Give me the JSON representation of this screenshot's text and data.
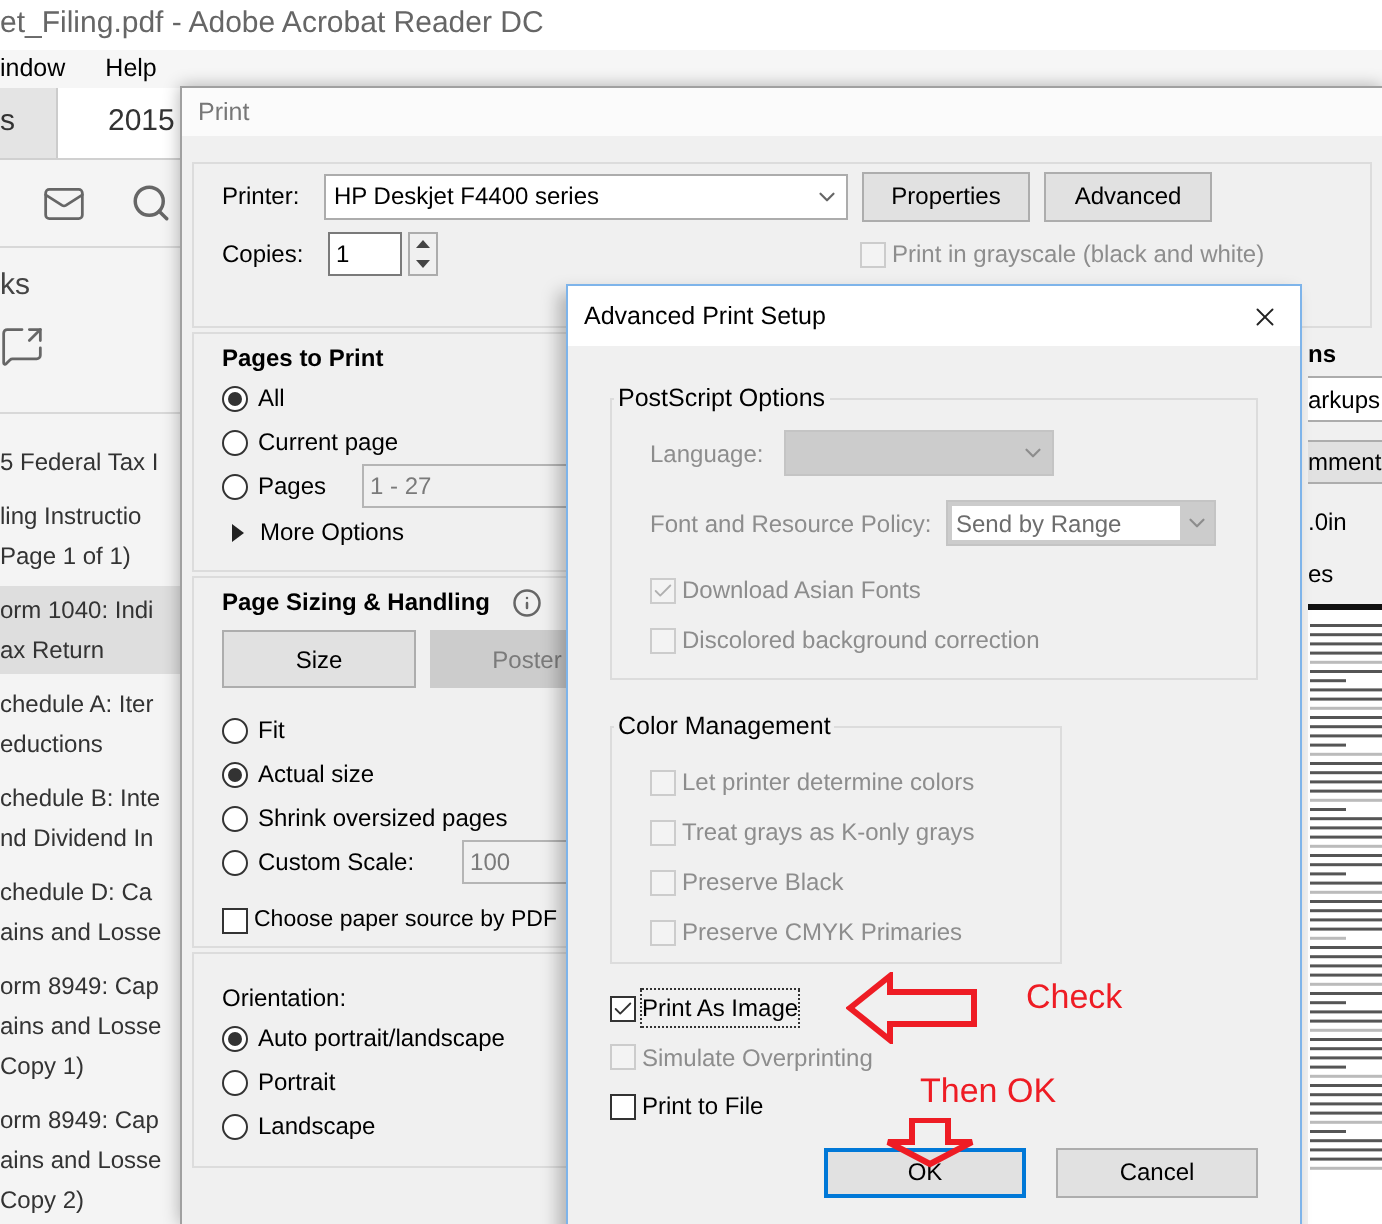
{
  "app_window": {
    "title": "et_Filing.pdf - Adobe Acrobat Reader DC",
    "menu": [
      "indow",
      "Help"
    ],
    "tabs": [
      {
        "label": "s",
        "selected": false
      },
      {
        "label": "2015",
        "selected": true
      }
    ],
    "panel_title": "ks",
    "bookmarks": [
      {
        "lines": [
          "5 Federal Tax I"
        ],
        "selected": false
      },
      {
        "lines": [
          "ling Instructio",
          "Page 1 of 1)"
        ],
        "selected": false
      },
      {
        "lines": [
          "orm 1040: Indi",
          "ax Return"
        ],
        "selected": true
      },
      {
        "lines": [
          "chedule A: Iter",
          "eductions"
        ],
        "selected": false
      },
      {
        "lines": [
          "chedule B: Inte",
          "nd Dividend In"
        ],
        "selected": false
      },
      {
        "lines": [
          "chedule D: Ca",
          "ains and Losse"
        ],
        "selected": false
      },
      {
        "lines": [
          "orm 8949: Cap",
          "ains and Losse",
          "Copy 1)"
        ],
        "selected": false
      },
      {
        "lines": [
          "orm 8949: Cap",
          "ains and Losse",
          "Copy 2)"
        ],
        "selected": false
      }
    ]
  },
  "print_dialog": {
    "title": "Print",
    "printer_label": "Printer:",
    "printer": "HP Deskjet F4400 series",
    "buttons": [
      "Properties",
      "Advanced"
    ],
    "copies_label": "Copies:",
    "copies": "1",
    "grayscale": {
      "label": "Print in grayscale (black and white)",
      "checked": false,
      "disabled": true
    },
    "pages_to_print": {
      "heading": "Pages to Print",
      "options": [
        {
          "label": "All",
          "selected": true
        },
        {
          "label": "Current page",
          "selected": false
        },
        {
          "label": "Pages",
          "selected": false
        }
      ],
      "pages_range": "1 - 27",
      "more_options": "More Options"
    },
    "page_sizing": {
      "heading": "Page Sizing & Handling",
      "modes": [
        {
          "label": "Size",
          "selected": true
        },
        {
          "label": "Poster",
          "selected": false
        }
      ],
      "options": [
        {
          "label": "Fit",
          "selected": false
        },
        {
          "label": "Actual size",
          "selected": true
        },
        {
          "label": "Shrink oversized pages",
          "selected": false
        },
        {
          "label": "Custom Scale:",
          "selected": false
        }
      ],
      "scale": "100",
      "paper_source": {
        "label": "Choose paper source by PDF",
        "checked": false
      }
    },
    "orientation": {
      "heading": "Orientation:",
      "options": [
        {
          "label": "Auto portrait/landscape",
          "selected": true
        },
        {
          "label": "Portrait",
          "selected": false
        },
        {
          "label": "Landscape",
          "selected": false
        }
      ]
    },
    "side_panel": {
      "heading": "ns",
      "select": "arkups",
      "button": "mment",
      "size": ".0in",
      "pages": "es"
    }
  },
  "advanced_dialog": {
    "title": "Advanced Print Setup",
    "postscript": {
      "heading": "PostScript Options",
      "language_label": "Language:",
      "font_policy_label": "Font and Resource Policy:",
      "font_policy": "Send by Range",
      "options": [
        {
          "label": "Download Asian Fonts",
          "checked": true,
          "disabled": true
        },
        {
          "label": "Discolored background correction",
          "checked": false,
          "disabled": true
        }
      ]
    },
    "color_management": {
      "heading": "Color Management",
      "options": [
        {
          "label": "Let printer determine colors",
          "checked": false,
          "disabled": true
        },
        {
          "label": "Treat grays as K-only grays",
          "checked": false,
          "disabled": true
        },
        {
          "label": "Preserve Black",
          "checked": false,
          "disabled": true
        },
        {
          "label": "Preserve CMYK Primaries",
          "checked": false,
          "disabled": true
        }
      ]
    },
    "options": [
      {
        "label": "Print As Image",
        "checked": true,
        "disabled": false
      },
      {
        "label": "Simulate Overprinting",
        "checked": false,
        "disabled": true
      },
      {
        "label": "Print to File",
        "checked": false,
        "disabled": false
      }
    ],
    "buttons": [
      {
        "label": "OK",
        "default": true
      },
      {
        "label": "Cancel",
        "default": false
      }
    ]
  },
  "annotations": [
    {
      "kind": "arrow-left",
      "text": "Check"
    },
    {
      "kind": "arrow-down",
      "text": "Then OK"
    }
  ]
}
